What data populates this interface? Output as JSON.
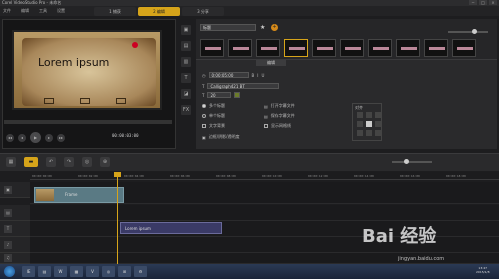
{
  "window": {
    "title": "Corel VideoStudio Pro - 未命名",
    "btn_min": "−",
    "btn_max": "□",
    "btn_close": "×"
  },
  "menu": [
    "文件",
    "编辑",
    "工具",
    "设置"
  ],
  "steps": [
    {
      "label": "1 捕获"
    },
    {
      "label": "2 编辑",
      "active": true
    },
    {
      "label": "3 分享"
    }
  ],
  "preview": {
    "title_text": "Lorem ipsum",
    "timecode": "00:00:03:00"
  },
  "preview_controls": [
    "◂◂",
    "◂",
    "▶",
    "▸",
    "▸▸"
  ],
  "sidebar_icons": [
    "▣",
    "▤",
    "▥",
    "T",
    "◪",
    "FX"
  ],
  "library": {
    "category": "标题",
    "star_icon": "★",
    "add_icon": "+"
  },
  "options": {
    "tab": "编辑",
    "duration": "0:00:05:00",
    "font": "Calligraph421 BT",
    "size": "20",
    "opt1": "多个标题",
    "opt2": "单个标题",
    "opt3": "文字背景",
    "opt4": "边框/阴影/透明度",
    "chk1": "打开字幕文件",
    "chk2": "保存字幕文件",
    "chk3": "显示网格线",
    "align_label": "对齐"
  },
  "toolbar_icons": [
    "▦",
    "▬",
    "↶",
    "↷",
    "◎",
    "⊕"
  ],
  "ruler": [
    "00:00:00:00",
    "00:00:02:00",
    "00:00:04:00",
    "00:00:06:00",
    "00:00:08:00",
    "00:00:10:00",
    "00:00:12:00",
    "00:00:14:00",
    "00:00:16:00",
    "00:00:18:00"
  ],
  "tracks": {
    "video_clip": "Frame",
    "title_clip": "Lorem ipsum",
    "head_icons": [
      "▣",
      "▤",
      "T",
      "♪",
      "♫"
    ]
  },
  "taskbar": {
    "start_icon": "⊞",
    "tasks": [
      "IE",
      "▤",
      "W",
      "▦",
      "V",
      "◎",
      "⊞",
      "⚙"
    ],
    "time": "13:47",
    "date": "2015/1/8"
  },
  "watermark": {
    "main": "Bai 经验",
    "sub": "jingyan.baidu.com"
  }
}
